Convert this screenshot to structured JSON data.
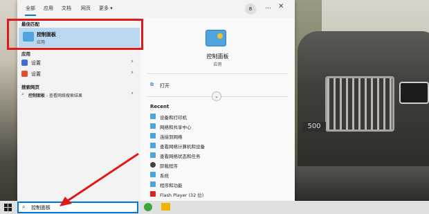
{
  "tabs": [
    {
      "label": "全部",
      "active": true
    },
    {
      "label": "应用"
    },
    {
      "label": "文档"
    },
    {
      "label": "网页"
    },
    {
      "label": "更多 ▾"
    }
  ],
  "badge_count": "8",
  "more_icon": "…",
  "close_icon": "✕",
  "left": {
    "best_match_title": "最佳匹配",
    "best_match": {
      "name": "控制面板",
      "type": "应用"
    },
    "apps_title": "应用",
    "apps": [
      {
        "label": "设置",
        "icon": "settings-icon",
        "color": "#3b6fd6"
      },
      {
        "label": "设置",
        "icon": "settings-icon",
        "color": "#e0502c"
      }
    ],
    "web_title": "搜索网页",
    "web_result": {
      "label": "控制面板",
      "suffix": " - 查看网络搜索结果"
    }
  },
  "right": {
    "title": "控制面板",
    "subtitle": "应用",
    "open_label": "打开",
    "recent_title": "Recent",
    "recent": [
      {
        "label": "设备和打印机",
        "color": "#4ea4df"
      },
      {
        "label": "网络和共享中心",
        "color": "#4ea4df"
      },
      {
        "label": "连接到网络",
        "color": "#4ea4df"
      },
      {
        "label": "查看网络计算机和设备",
        "color": "#4ea4df"
      },
      {
        "label": "查看网络状态和任务",
        "color": "#4ea4df"
      },
      {
        "label": "卸载程序",
        "color": "#444444"
      },
      {
        "label": "系统",
        "color": "#4ea4df"
      },
      {
        "label": "程序和功能",
        "color": "#4ea4df"
      },
      {
        "label": "Flash Player (32 位)",
        "color": "#d8281c"
      }
    ]
  },
  "taskbar": {
    "search_value": "控制面板"
  },
  "car_plate": "500",
  "colors": {
    "accent": "#0078d4",
    "highlight_box": "#e01818"
  }
}
